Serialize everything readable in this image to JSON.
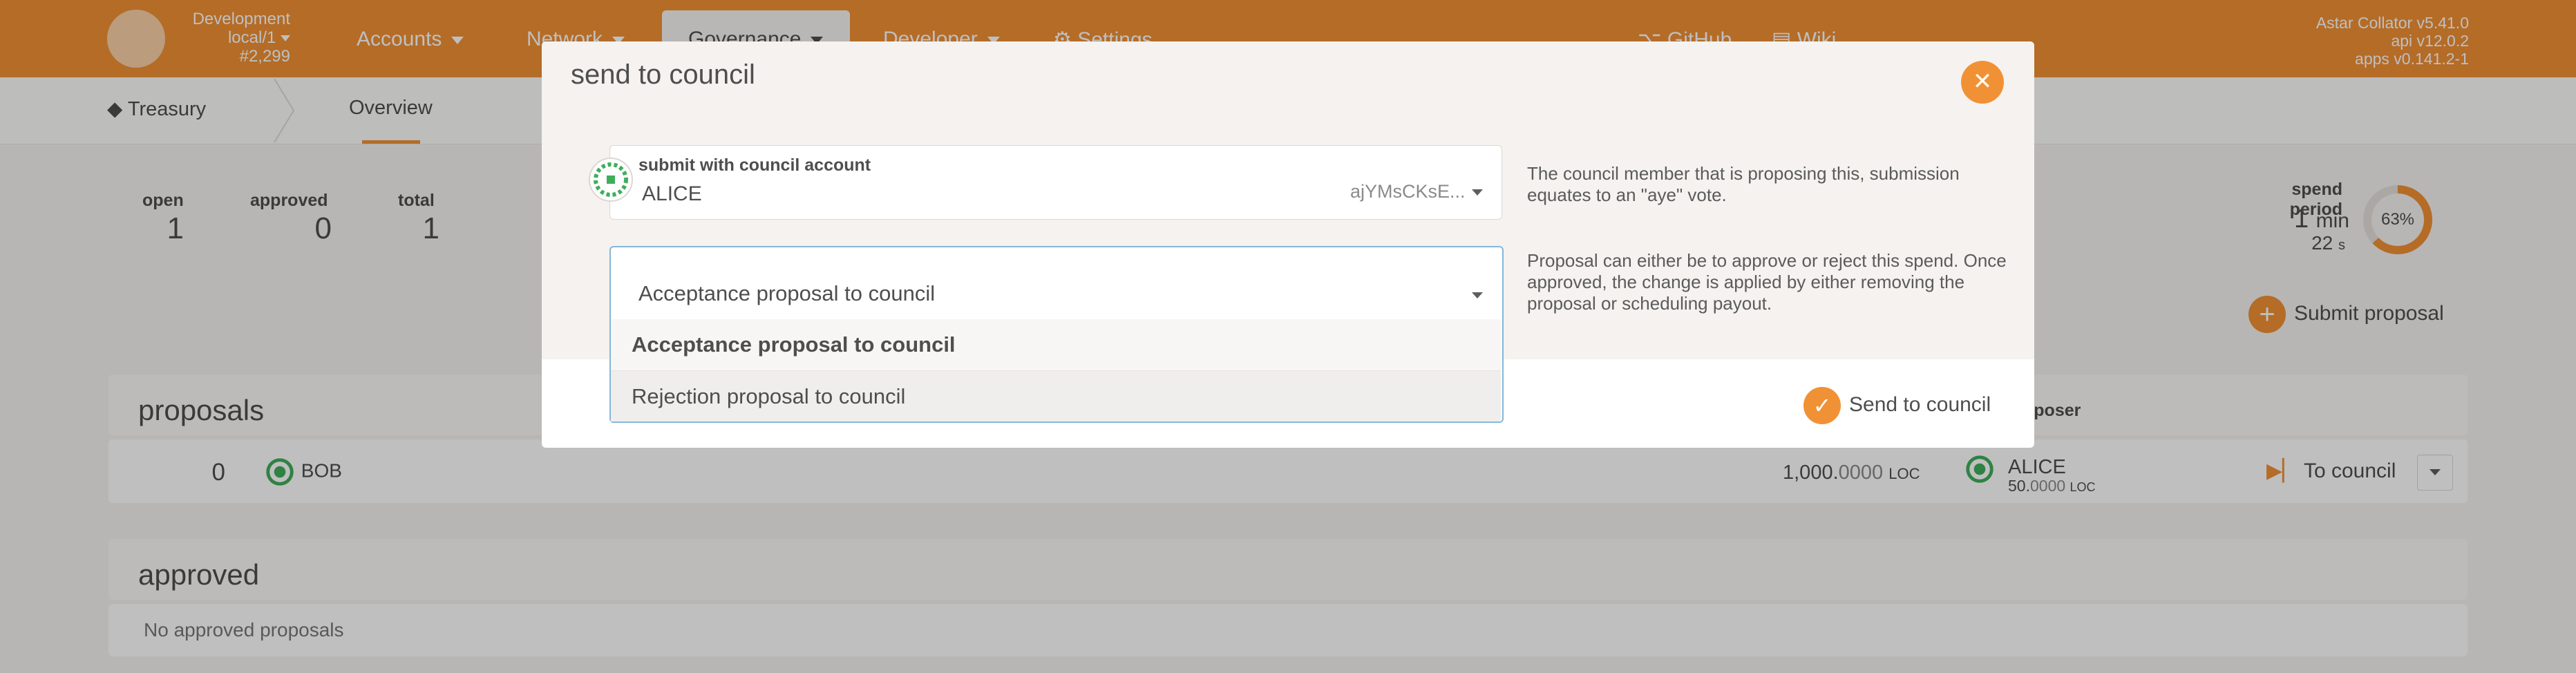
{
  "topbar": {
    "chain_name": "Development",
    "chain_node": "local/1",
    "block": "#2,299",
    "nav": {
      "accounts": "Accounts",
      "network": "Network",
      "governance": "Governance",
      "developer": "Developer",
      "settings": "Settings",
      "github": "GitHub",
      "wiki": "Wiki"
    },
    "versions": {
      "node": "Astar Collator v5.41.0",
      "api": "api v12.0.2",
      "apps": "apps v0.141.2-1"
    }
  },
  "subnav": {
    "treasury": "Treasury",
    "overview": "Overview"
  },
  "summary": {
    "open_label": "open",
    "open_value": "1",
    "approved_label": "approved",
    "approved_value": "0",
    "total_label": "total",
    "total_value": "1",
    "spend_label": "spend period",
    "spend_min": "1",
    "spend_min_unit": "min",
    "spend_sec": "22",
    "spend_sec_unit": "s",
    "spend_percent": "63%",
    "submit_label": "Submit proposal"
  },
  "proposals": {
    "title": "proposals",
    "proposer_header": "oposer",
    "row": {
      "index": "0",
      "beneficiary": "BOB",
      "value_int": "1,000.",
      "value_dec": "0000",
      "value_unit": "LOC",
      "proposer": "ALICE",
      "bond_int": "50.",
      "bond_dec": "0000",
      "bond_unit": "LOC",
      "action": "To council"
    }
  },
  "approved": {
    "title": "approved",
    "empty": "No approved proposals"
  },
  "modal": {
    "title": "send to council",
    "account_label": "submit with council account",
    "account_name": "ALICE",
    "account_address": "ajYMsCKsE...",
    "account_help": "The council member that is proposing this, submission equates to an \"aye\" vote.",
    "proposal_value": "Acceptance proposal to council",
    "proposal_help": "Proposal can either be to approve or reject this spend. Once approved, the change is applied by either removing the proposal or scheduling payout.",
    "options": [
      "Acceptance proposal to council",
      "Rejection proposal to council"
    ],
    "send_label": "Send to council"
  },
  "colors": {
    "accent": "#f19135",
    "focus_border": "#85b7d9"
  }
}
